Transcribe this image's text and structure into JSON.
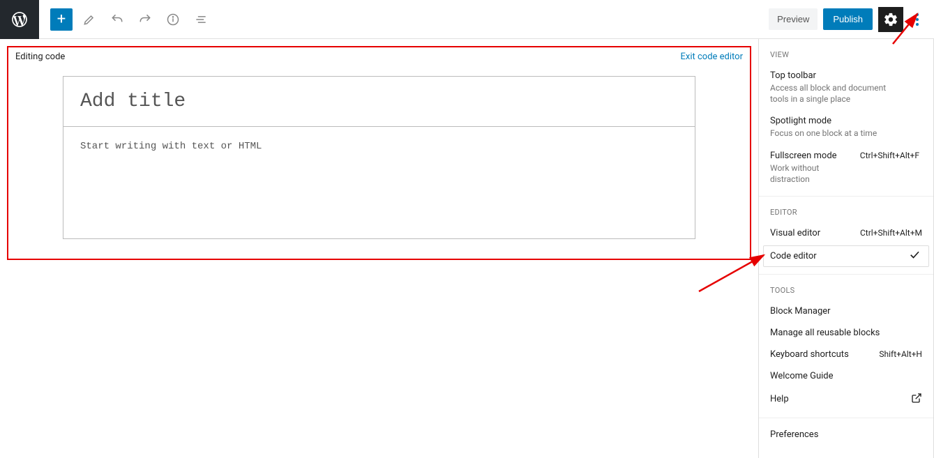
{
  "toolbar": {
    "preview_label": "Preview",
    "publish_label": "Publish"
  },
  "editor": {
    "editing_label": "Editing code",
    "exit_label": "Exit code editor",
    "title_placeholder": "Add title",
    "body_placeholder": "Start writing with text or HTML"
  },
  "dropdown": {
    "view_heading": "View",
    "view_items": [
      {
        "label": "Top toolbar",
        "desc": "Access all block and document tools in a single place"
      },
      {
        "label": "Spotlight mode",
        "desc": "Focus on one block at a time"
      },
      {
        "label": "Fullscreen mode",
        "desc": "Work without distraction",
        "shortcut": "Ctrl+Shift+Alt+F",
        "checked": true
      }
    ],
    "editor_heading": "Editor",
    "editor_items": [
      {
        "label": "Visual editor",
        "shortcut": "Ctrl+Shift+Alt+M"
      },
      {
        "label": "Code editor",
        "checked": true,
        "selected": true
      }
    ],
    "tools_heading": "Tools",
    "tools_items": [
      {
        "label": "Block Manager"
      },
      {
        "label": "Manage all reusable blocks"
      },
      {
        "label": "Keyboard shortcuts",
        "shortcut": "Shift+Alt+H"
      },
      {
        "label": "Welcome Guide"
      },
      {
        "label": "Help",
        "external": true
      }
    ],
    "prefs_label": "Preferences"
  }
}
